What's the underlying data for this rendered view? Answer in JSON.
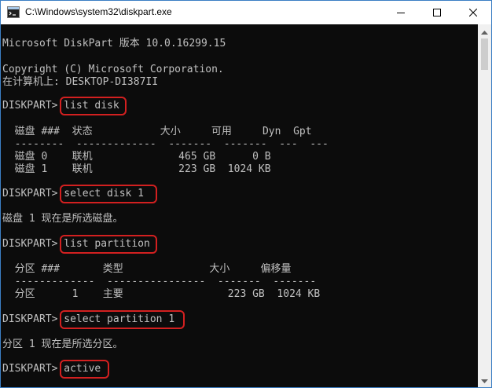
{
  "window": {
    "title": "C:\\Windows\\system32\\diskpart.exe"
  },
  "console": {
    "lines": [
      "Microsoft DiskPart 版本 10.0.16299.15",
      "Copyright (C) Microsoft Corporation.",
      "在计算机上: DESKTOP-DI387II",
      "DISKPART> list disk",
      "  磁盘 ###  状态           大小     可用     Dyn  Gpt",
      "  --------  -------------  -------  -------  ---  ---",
      "  磁盘 0    联机              465 GB      0 B",
      "  磁盘 1    联机              223 GB  1024 KB",
      "DISKPART> select disk 1",
      "磁盘 1 现在是所选磁盘。",
      "DISKPART> list partition",
      "  分区 ###       类型              大小     偏移量",
      "  -------------  ----------------  -------  -------",
      "  分区      1    主要                 223 GB  1024 KB",
      "DISKPART> select partition 1",
      "分区 1 现在是所选分区。",
      "DISKPART> active"
    ]
  },
  "icons": {
    "app": "console-app-icon",
    "minimize": "minimize-icon",
    "maximize": "maximize-icon",
    "close": "close-icon",
    "scroll_up": "scroll-up-arrow-icon",
    "scroll_down": "scroll-down-arrow-icon"
  },
  "colors": {
    "console_bg": "#0c0c0c",
    "console_text": "#c0c0c0",
    "highlight": "#d32020",
    "titlebar": "#ffffff"
  }
}
